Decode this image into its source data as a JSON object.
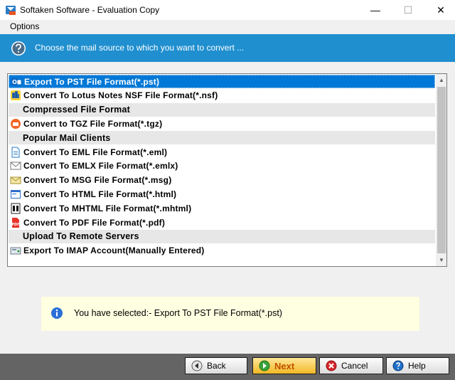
{
  "window": {
    "title": "Softaken Software - Evaluation Copy",
    "minimize_glyph": "—",
    "maximize_glyph": "☐",
    "close_glyph": "✕"
  },
  "menu": {
    "options_label": "Options"
  },
  "banner": {
    "text": "Choose the mail source to which you want to convert ..."
  },
  "list": {
    "items": [
      {
        "label": "Export To PST File Format(*.pst)",
        "kind": "item",
        "icon": "outlook-pst-icon",
        "selected": true
      },
      {
        "label": "Convert To Lotus Notes NSF File Format(*.nsf)",
        "kind": "item",
        "icon": "lotus-notes-icon"
      },
      {
        "label": "Compressed File Format",
        "kind": "group"
      },
      {
        "label": "Convert to TGZ File Format(*.tgz)",
        "kind": "item",
        "icon": "tgz-archive-icon"
      },
      {
        "label": "Popular Mail Clients",
        "kind": "group"
      },
      {
        "label": "Convert To EML File Format(*.eml)",
        "kind": "item",
        "icon": "eml-file-icon"
      },
      {
        "label": "Convert To EMLX File Format(*.emlx)",
        "kind": "item",
        "icon": "envelope-icon"
      },
      {
        "label": "Convert To MSG File Format(*.msg)",
        "kind": "item",
        "icon": "msg-file-icon"
      },
      {
        "label": "Convert To HTML File Format(*.html)",
        "kind": "item",
        "icon": "html-file-icon"
      },
      {
        "label": "Convert To MHTML File Format(*.mhtml)",
        "kind": "item",
        "icon": "mhtml-file-icon"
      },
      {
        "label": "Convert To PDF File Format(*.pdf)",
        "kind": "item",
        "icon": "pdf-file-icon"
      },
      {
        "label": "Upload To Remote Servers",
        "kind": "group"
      },
      {
        "label": "Export To IMAP Account(Manually Entered)",
        "kind": "item",
        "icon": "imap-server-icon"
      }
    ]
  },
  "info": {
    "text": "You have selected:- Export To PST File Format(*.pst)"
  },
  "buttons": {
    "back": "Back",
    "next": "Next",
    "cancel": "Cancel",
    "help": "Help"
  },
  "colors": {
    "banner": "#1f8fcf",
    "selection": "#0078d7",
    "info_background": "#ffffe1",
    "footer": "#646464",
    "next_text": "#c05000"
  }
}
